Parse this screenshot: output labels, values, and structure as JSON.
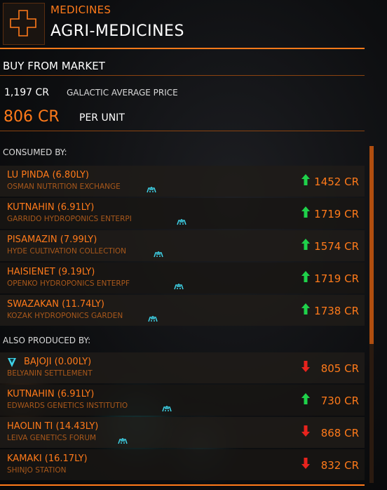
{
  "commodity": {
    "category": "MEDICINES",
    "name": "AGRI-MEDICINES",
    "icon": "medical-cross-icon"
  },
  "market": {
    "section_title": "BUY FROM MARKET",
    "galactic_avg_value": "1,197 CR",
    "galactic_avg_label": "GALACTIC AVERAGE PRICE",
    "unit_price": "806 CR",
    "unit_label": "PER UNIT"
  },
  "consumed_by": {
    "header": "CONSUMED BY:",
    "items": [
      {
        "name": "LU PINDA (6.80LY)",
        "station": "OSMAN NUTRITION EXCHANGE",
        "price": "1452 CR",
        "trend": "up"
      },
      {
        "name": "KUTNAHIN (6.91LY)",
        "station": "GARRIDO HYDROPONICS ENTERPI",
        "price": "1719 CR",
        "trend": "up"
      },
      {
        "name": "PISAMAZIN (7.99LY)",
        "station": "HYDE CULTIVATION COLLECTION",
        "price": "1574 CR",
        "trend": "up"
      },
      {
        "name": "HAISIENET (9.19LY)",
        "station": "OPENKO HYDROPONICS ENTERPF",
        "price": "1719 CR",
        "trend": "up"
      },
      {
        "name": "SWAZAKAN (11.74LY)",
        "station": "KOZAK HYDROPONICS GARDEN",
        "price": "1738 CR",
        "trend": "up"
      }
    ]
  },
  "also_produced_by": {
    "header": "ALSO PRODUCED BY:",
    "items": [
      {
        "name": "BAJOJI (0.00LY)",
        "station": "BELYANIN SETTLEMENT",
        "price": "805 CR",
        "trend": "down"
      },
      {
        "name": "KUTNAHIN (6.91LY)",
        "station": "EDWARDS GENETICS INSTITUTIO",
        "price": "730 CR",
        "trend": "up"
      },
      {
        "name": "HAOLIN TI (14.43LY)",
        "station": "LEIVA GENETICS FORUM",
        "price": "868 CR",
        "trend": "down"
      },
      {
        "name": "KAMAKI (16.17LY)",
        "station": "SHINJO STATION",
        "price": "832 CR",
        "trend": "down"
      }
    ]
  },
  "colors": {
    "accent": "#ff7a1a",
    "up": "#1fd14a",
    "down": "#e8231d",
    "faction_icon": "#3fd3e8"
  }
}
